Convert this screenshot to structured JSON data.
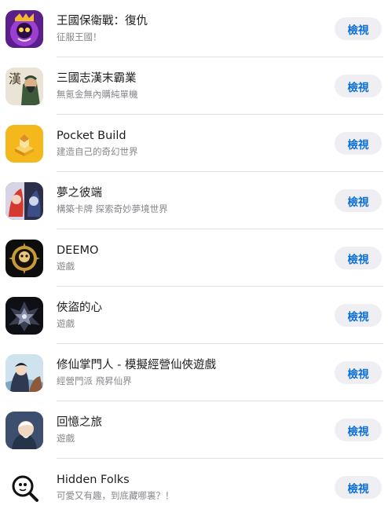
{
  "apps": [
    {
      "title": "王國保衛戰：復仇",
      "subtitle": "征服王國！",
      "button": "檢視",
      "icon": "kingdom-rush-vengeance-app-icon"
    },
    {
      "title": "三國志漢末霸業",
      "subtitle": "無氪金無內購純單機",
      "button": "檢視",
      "icon": "three-kingdoms-app-icon",
      "icon_text": "漢"
    },
    {
      "title": "Pocket Build",
      "subtitle": "建造自己的奇幻世界",
      "button": "檢視",
      "icon": "pocket-build-app-icon"
    },
    {
      "title": "夢之彼端",
      "subtitle": "構築卡牌 探索奇妙夢境世界",
      "button": "檢視",
      "icon": "dream-beyond-app-icon"
    },
    {
      "title": "DEEMO",
      "subtitle": "遊戲",
      "button": "檢視",
      "icon": "deemo-app-icon"
    },
    {
      "title": "俠盜的心",
      "subtitle": "遊戲",
      "button": "檢視",
      "icon": "rogue-heart-app-icon"
    },
    {
      "title": "修仙掌門人 - 模擬經營仙俠遊戲",
      "subtitle": "經營門派 飛昇仙界",
      "button": "檢視",
      "icon": "xiuxian-master-app-icon"
    },
    {
      "title": "回憶之旅",
      "subtitle": "遊戲",
      "button": "檢視",
      "icon": "memory-journey-app-icon"
    },
    {
      "title": "Hidden Folks",
      "subtitle": "可愛又有趣，到底藏哪裏？！",
      "button": "檢視",
      "icon": "hidden-folks-app-icon"
    }
  ]
}
